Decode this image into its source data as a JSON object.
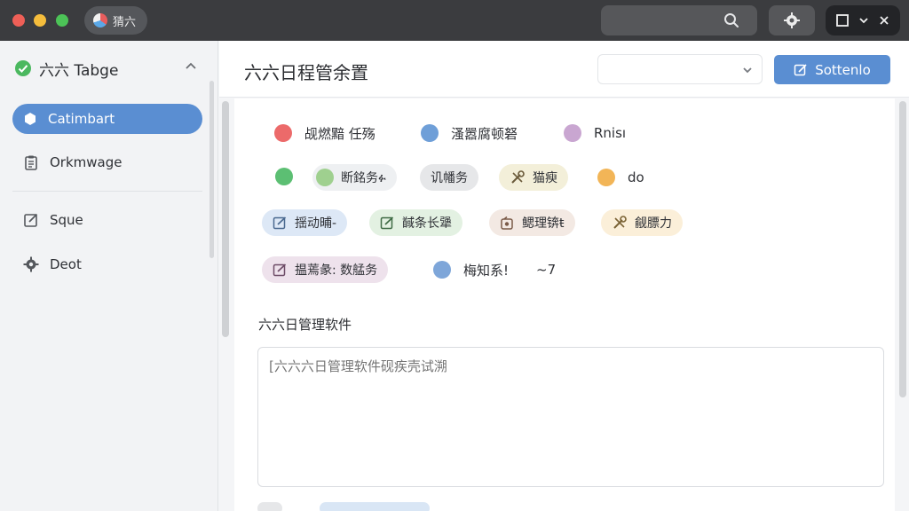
{
  "titlebar": {
    "app_label": "猜六",
    "colors": {
      "close": "#ee5f57",
      "minimize": "#f5bd3c",
      "zoom": "#4cc357"
    }
  },
  "sidebar": {
    "header": "六六 Tabge",
    "items": [
      {
        "label": "Catimbart",
        "icon": "hexagon-icon",
        "active": true
      },
      {
        "label": "Orkmwage",
        "icon": "clipboard-icon",
        "active": false
      },
      {
        "label": "Sque",
        "icon": "edit-icon",
        "active": false
      },
      {
        "label": "Deot",
        "icon": "gear-icon",
        "active": false
      }
    ]
  },
  "header": {
    "title": "六六日程管余置",
    "dropdown_value": "",
    "primary_button": "Sottenlo"
  },
  "legend_rows": [
    [
      {
        "label": "觇燃黯 任殇",
        "color": "#ec6a6a"
      },
      {
        "label": "溞嚣腐顿砮",
        "color": "#6f9fd8"
      },
      {
        "label": "Rnisı",
        "color": "#c9a6d1"
      }
    ]
  ],
  "row2": {
    "dot1_color": "#5cbf73",
    "tag1": {
      "label": "断銘务ፉ",
      "dot_color": "#9fd08f",
      "bg": "#eef0f2"
    },
    "tag2": {
      "label": "讥幡务",
      "bg": "#e6e7e9"
    },
    "tag3": {
      "label": "猫瘐",
      "icon": "tools-icon",
      "bg": "#f3efd9"
    },
    "dot2": {
      "label": "do",
      "color": "#f2b557"
    }
  },
  "row3": [
    {
      "label": "揺动晡-",
      "icon": "edit-icon",
      "bg": "#dde8f6"
    },
    {
      "label": "馘条长犟",
      "icon": "edit-icon",
      "bg": "#e3f1e2"
    },
    {
      "label": "鳃理锛ŧ",
      "icon": "tag-icon",
      "bg": "#f3e9e3"
    },
    {
      "label": "觎膘力",
      "icon": "tools-icon",
      "bg": "#fbefd9"
    }
  ],
  "row4": {
    "tag": {
      "label": "揾蔫彖:  数艋务",
      "icon": "edit-icon",
      "bg": "#eee2ec"
    },
    "dot": {
      "label": "梅知系!",
      "color": "#7ea6d9"
    },
    "extra": "~7"
  },
  "editor": {
    "section_label": "六六日管理软件",
    "placeholder": "[六六六日管理软件砚疾壳试溯"
  }
}
